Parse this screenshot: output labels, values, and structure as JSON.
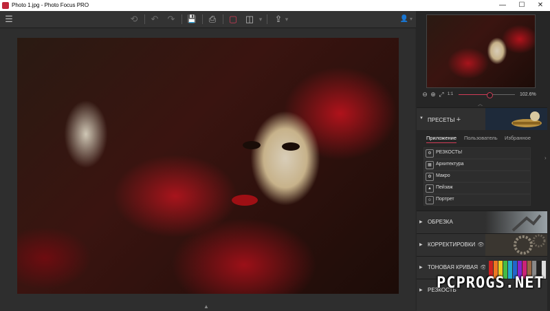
{
  "window": {
    "title": "Photo 1.jpg - Photo Focus PRO",
    "controls": {
      "minimize": "—",
      "maximize": "☐",
      "close": "✕"
    }
  },
  "toolbar": {
    "menu_icon": "☰",
    "undo_all_icon": "⟲",
    "undo_icon": "↶",
    "redo_icon": "↷",
    "save_icon": "💾",
    "print_icon": "⎙",
    "single_view_icon": "▢",
    "split_view_icon": "◫",
    "dropdown_icon": "▾",
    "share_icon": "⇪",
    "user_icon": "👤"
  },
  "navigator": {
    "zoom_out_icon": "⊖",
    "zoom_in_icon": "⊕",
    "fit_icon": "⤢",
    "actual_icon": "1:1",
    "zoom_percent": "102.6%",
    "slider_fraction": 0.55
  },
  "presets": {
    "header": "ПРЕСЕТЫ",
    "add_icon": "+",
    "tabs": [
      "Приложение",
      "Пользователь",
      "Избранное"
    ],
    "active_tab": 0,
    "items": [
      {
        "label": "РЕЗКОСТЬ!",
        "icon": "⚙"
      },
      {
        "label": "Архитектура",
        "icon": "▦"
      },
      {
        "label": "Макро",
        "icon": "✿"
      },
      {
        "label": "Пейзаж",
        "icon": "▲"
      },
      {
        "label": "Портрет",
        "icon": "☺"
      }
    ]
  },
  "sections": [
    {
      "label": "ОБРЕЗКА",
      "eye": ""
    },
    {
      "label": "КОРРЕКТИРОВКИ",
      "eye": "👁"
    },
    {
      "label": "ТОНОВАЯ КРИВАЯ",
      "eye": "👁"
    },
    {
      "label": "РЕЗКОСТЬ",
      "eye": ""
    }
  ],
  "watermark": "PCPROGS.NET",
  "colors": {
    "accent": "#d23c57",
    "panel_bg": "#262626",
    "toolbar_bg": "#333333"
  }
}
